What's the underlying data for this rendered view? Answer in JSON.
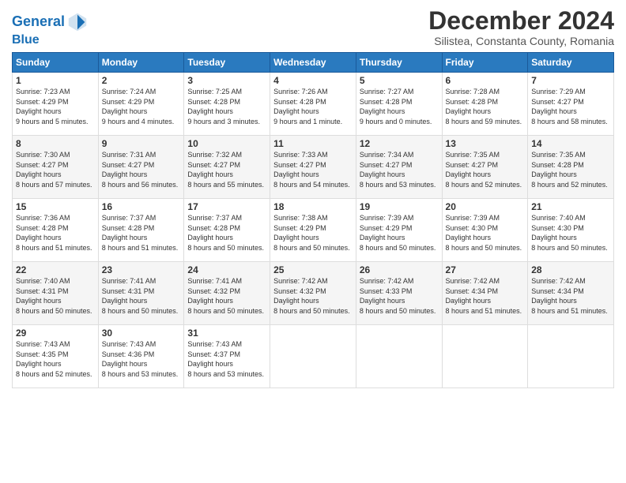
{
  "logo": {
    "line1": "General",
    "line2": "Blue"
  },
  "title": "December 2024",
  "subtitle": "Silistea, Constanta County, Romania",
  "header": {
    "days": [
      "Sunday",
      "Monday",
      "Tuesday",
      "Wednesday",
      "Thursday",
      "Friday",
      "Saturday"
    ]
  },
  "weeks": [
    [
      {
        "day": "1",
        "sunrise": "7:23 AM",
        "sunset": "4:29 PM",
        "daylight": "9 hours and 5 minutes."
      },
      {
        "day": "2",
        "sunrise": "7:24 AM",
        "sunset": "4:29 PM",
        "daylight": "9 hours and 4 minutes."
      },
      {
        "day": "3",
        "sunrise": "7:25 AM",
        "sunset": "4:28 PM",
        "daylight": "9 hours and 3 minutes."
      },
      {
        "day": "4",
        "sunrise": "7:26 AM",
        "sunset": "4:28 PM",
        "daylight": "9 hours and 1 minute."
      },
      {
        "day": "5",
        "sunrise": "7:27 AM",
        "sunset": "4:28 PM",
        "daylight": "9 hours and 0 minutes."
      },
      {
        "day": "6",
        "sunrise": "7:28 AM",
        "sunset": "4:28 PM",
        "daylight": "8 hours and 59 minutes."
      },
      {
        "day": "7",
        "sunrise": "7:29 AM",
        "sunset": "4:27 PM",
        "daylight": "8 hours and 58 minutes."
      }
    ],
    [
      {
        "day": "8",
        "sunrise": "7:30 AM",
        "sunset": "4:27 PM",
        "daylight": "8 hours and 57 minutes."
      },
      {
        "day": "9",
        "sunrise": "7:31 AM",
        "sunset": "4:27 PM",
        "daylight": "8 hours and 56 minutes."
      },
      {
        "day": "10",
        "sunrise": "7:32 AM",
        "sunset": "4:27 PM",
        "daylight": "8 hours and 55 minutes."
      },
      {
        "day": "11",
        "sunrise": "7:33 AM",
        "sunset": "4:27 PM",
        "daylight": "8 hours and 54 minutes."
      },
      {
        "day": "12",
        "sunrise": "7:34 AM",
        "sunset": "4:27 PM",
        "daylight": "8 hours and 53 minutes."
      },
      {
        "day": "13",
        "sunrise": "7:35 AM",
        "sunset": "4:27 PM",
        "daylight": "8 hours and 52 minutes."
      },
      {
        "day": "14",
        "sunrise": "7:35 AM",
        "sunset": "4:28 PM",
        "daylight": "8 hours and 52 minutes."
      }
    ],
    [
      {
        "day": "15",
        "sunrise": "7:36 AM",
        "sunset": "4:28 PM",
        "daylight": "8 hours and 51 minutes."
      },
      {
        "day": "16",
        "sunrise": "7:37 AM",
        "sunset": "4:28 PM",
        "daylight": "8 hours and 51 minutes."
      },
      {
        "day": "17",
        "sunrise": "7:37 AM",
        "sunset": "4:28 PM",
        "daylight": "8 hours and 50 minutes."
      },
      {
        "day": "18",
        "sunrise": "7:38 AM",
        "sunset": "4:29 PM",
        "daylight": "8 hours and 50 minutes."
      },
      {
        "day": "19",
        "sunrise": "7:39 AM",
        "sunset": "4:29 PM",
        "daylight": "8 hours and 50 minutes."
      },
      {
        "day": "20",
        "sunrise": "7:39 AM",
        "sunset": "4:30 PM",
        "daylight": "8 hours and 50 minutes."
      },
      {
        "day": "21",
        "sunrise": "7:40 AM",
        "sunset": "4:30 PM",
        "daylight": "8 hours and 50 minutes."
      }
    ],
    [
      {
        "day": "22",
        "sunrise": "7:40 AM",
        "sunset": "4:31 PM",
        "daylight": "8 hours and 50 minutes."
      },
      {
        "day": "23",
        "sunrise": "7:41 AM",
        "sunset": "4:31 PM",
        "daylight": "8 hours and 50 minutes."
      },
      {
        "day": "24",
        "sunrise": "7:41 AM",
        "sunset": "4:32 PM",
        "daylight": "8 hours and 50 minutes."
      },
      {
        "day": "25",
        "sunrise": "7:42 AM",
        "sunset": "4:32 PM",
        "daylight": "8 hours and 50 minutes."
      },
      {
        "day": "26",
        "sunrise": "7:42 AM",
        "sunset": "4:33 PM",
        "daylight": "8 hours and 50 minutes."
      },
      {
        "day": "27",
        "sunrise": "7:42 AM",
        "sunset": "4:34 PM",
        "daylight": "8 hours and 51 minutes."
      },
      {
        "day": "28",
        "sunrise": "7:42 AM",
        "sunset": "4:34 PM",
        "daylight": "8 hours and 51 minutes."
      }
    ],
    [
      {
        "day": "29",
        "sunrise": "7:43 AM",
        "sunset": "4:35 PM",
        "daylight": "8 hours and 52 minutes."
      },
      {
        "day": "30",
        "sunrise": "7:43 AM",
        "sunset": "4:36 PM",
        "daylight": "8 hours and 53 minutes."
      },
      {
        "day": "31",
        "sunrise": "7:43 AM",
        "sunset": "4:37 PM",
        "daylight": "8 hours and 53 minutes."
      },
      null,
      null,
      null,
      null
    ]
  ]
}
